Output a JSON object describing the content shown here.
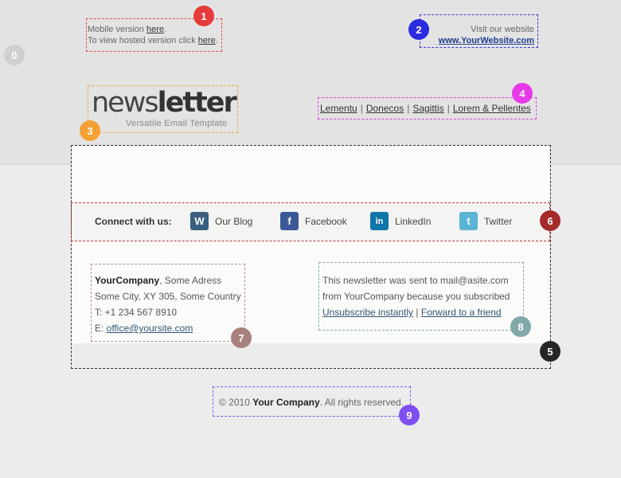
{
  "header": {
    "mobile_prefix": "Mobile version ",
    "mobile_link": "here",
    "mobile_suffix": ".",
    "hosted_prefix": "To view hosted version click ",
    "hosted_link": "here",
    "hosted_suffix": ".",
    "visit_label": "Visit our website",
    "website_link": "www.YourWebsite.com"
  },
  "logo": {
    "word_light": "news",
    "word_bold": "letter",
    "tagline": "Versatile Email Template"
  },
  "nav": {
    "items": [
      "Lementu",
      "Donecos",
      "Sagittis",
      "Lorem & Pellentes"
    ],
    "separator": "|"
  },
  "social": {
    "connect_label": "Connect with us:",
    "items": [
      {
        "label": "Our Blog",
        "icon": "wordpress-icon",
        "color": "#3a5f7f",
        "glyph": "W"
      },
      {
        "label": "Facebook",
        "icon": "facebook-icon",
        "color": "#3b5998",
        "glyph": "f"
      },
      {
        "label": "LinkedIn",
        "icon": "linkedin-icon",
        "color": "#0e76a8",
        "glyph": "in"
      },
      {
        "label": "Twitter",
        "icon": "twitter-icon",
        "color": "#5ab4d6",
        "glyph": "t"
      }
    ]
  },
  "address": {
    "company": "YourCompany",
    "line1_rest": ", Some Adress",
    "line2": "Some City, XY 305, Some Country",
    "phone": "T: +1 234 567 8910",
    "email_prefix": "E: ",
    "email": "office@yoursite.com"
  },
  "notice": {
    "line1": "This newsletter was sent to mail@asite.com",
    "line2": "from YourCompany because you subscribed",
    "unsubscribe": "Unsubscribe instantly",
    "separator": " | ",
    "forward": "Forward to a friend"
  },
  "footer": {
    "prefix": "© 2010 ",
    "company": "Your Company",
    "suffix": ". All rights reserved."
  },
  "markers": [
    {
      "label": "0",
      "color": "#cfcfcf"
    },
    {
      "label": "1",
      "color": "#e53b3b"
    },
    {
      "label": "2",
      "color": "#2b2be0"
    },
    {
      "label": "3",
      "color": "#f5a032"
    },
    {
      "label": "4",
      "color": "#e83ae8"
    },
    {
      "label": "5",
      "color": "#262626"
    },
    {
      "label": "6",
      "color": "#a52a2a"
    },
    {
      "label": "7",
      "color": "#a7817d"
    },
    {
      "label": "8",
      "color": "#82a9a9"
    },
    {
      "label": "9",
      "color": "#7e4ff0"
    }
  ]
}
